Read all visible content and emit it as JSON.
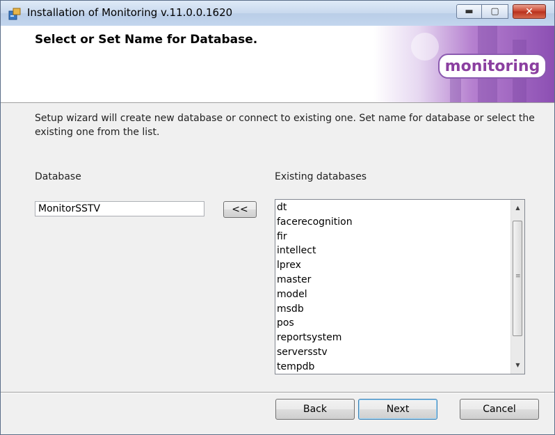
{
  "window": {
    "title": "Installation of Monitoring v.11.0.0.1620",
    "controls": {
      "minimize": "▬",
      "maximize": "▢",
      "close": "✕"
    }
  },
  "banner": {
    "title": "Select or Set Name for Database.",
    "logo_text": "monitoring"
  },
  "description": "Setup wizard will create new database or connect to existing one. Set name for database or select the existing one from the list.",
  "database": {
    "label": "Database",
    "value": "MonitorSSTV",
    "move_button": "<<"
  },
  "existing": {
    "label": "Existing databases",
    "items": [
      "dt",
      "facerecognition",
      "fir",
      "intellect",
      "lprex",
      "master",
      "model",
      "msdb",
      "pos",
      "reportsystem",
      "serversstv",
      "tempdb"
    ],
    "scroll_up": "▲",
    "scroll_down": "▼",
    "grip": "≡"
  },
  "buttons": {
    "back": "Back",
    "next": "Next",
    "cancel": "Cancel"
  },
  "colors": {
    "accent": "#8b3fa0",
    "title_bar": "#c8d9ee",
    "close_button": "#c8432e"
  },
  "icons": [
    "installer-icon",
    "minimize-icon",
    "maximize-icon",
    "close-icon",
    "store-icon",
    "scroll-up-icon",
    "scroll-down-icon"
  ]
}
